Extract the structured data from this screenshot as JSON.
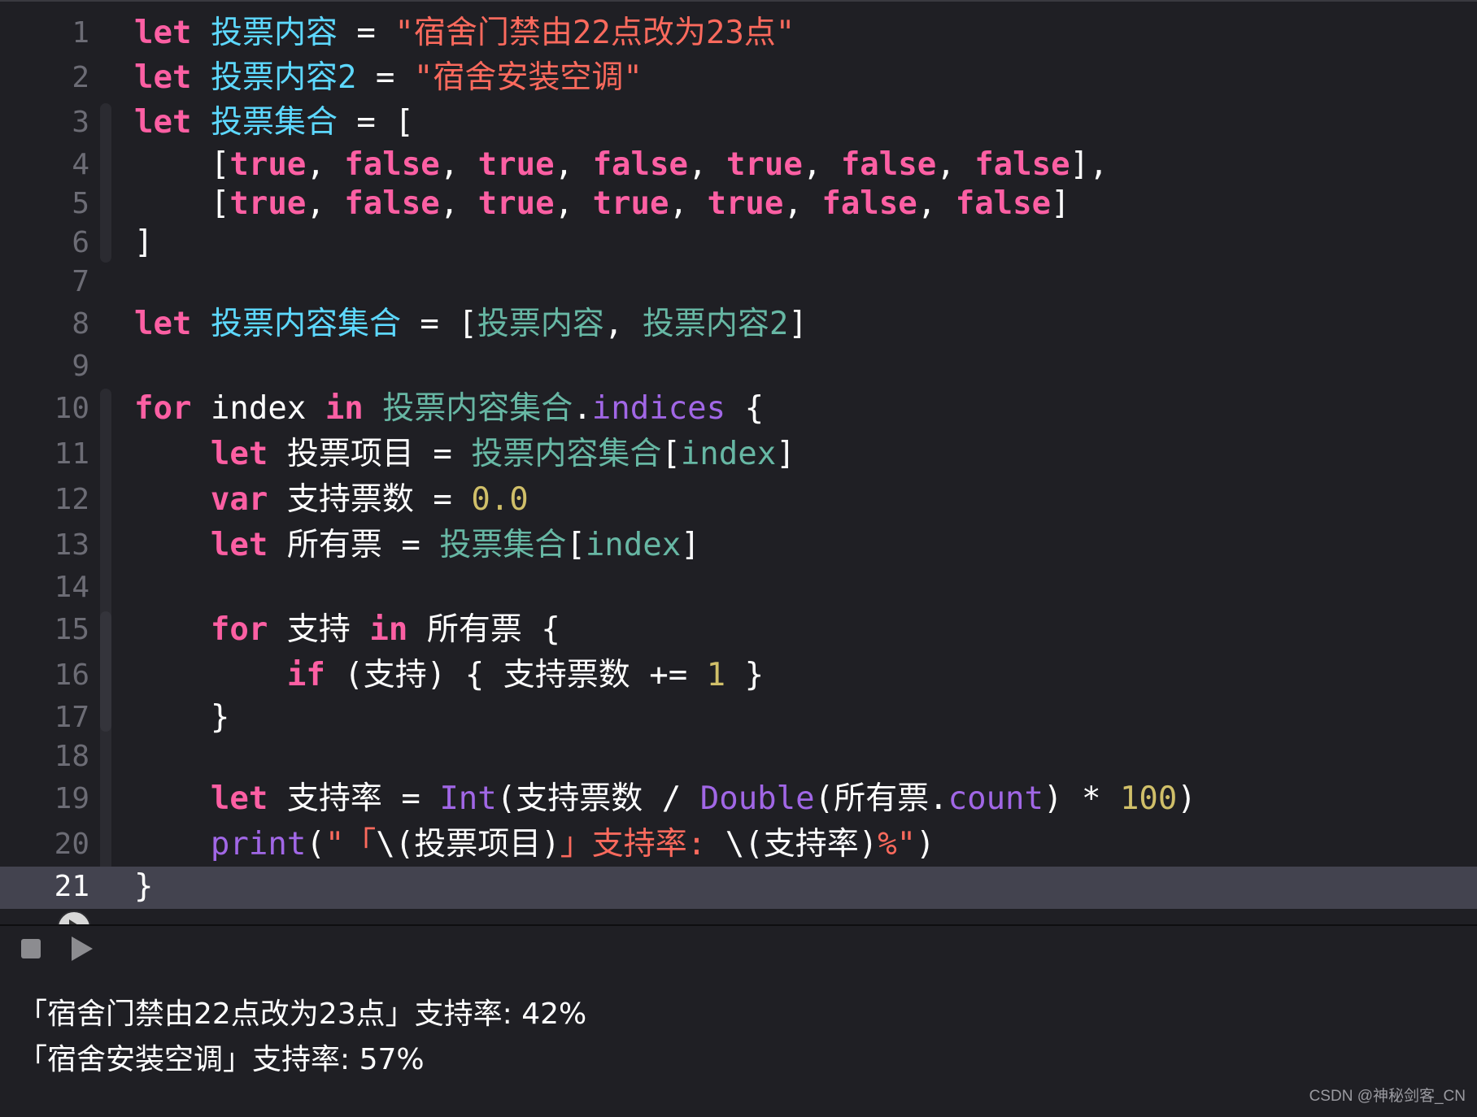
{
  "editor": {
    "line_numbers": [
      "1",
      "2",
      "3",
      "4",
      "5",
      "6",
      "7",
      "8",
      "9",
      "10",
      "11",
      "12",
      "13",
      "14",
      "15",
      "16",
      "17",
      "18",
      "19",
      "20",
      "21"
    ],
    "current_line": "21",
    "tokens": {
      "let": "let",
      "var": "var",
      "for": "for",
      "in": "in",
      "if": "if",
      "true": "true",
      "false": "false",
      "eq": " = ",
      "comma": ", ",
      "lbracket": "[",
      "rbracket": "]",
      "lbrace": "{",
      "rbrace": "}",
      "v_content": "投票内容",
      "v_content2": "投票内容2",
      "v_set": "投票集合",
      "v_content_set": "投票内容集合",
      "v_item": "投票项目",
      "v_votes": "支持票数",
      "v_all": "所有票",
      "v_support": "支持",
      "v_rate": "支持率",
      "index": "index",
      "s1": "\"宿舍门禁由22点改为23点\"",
      "s2": "\"宿舍安装空调\"",
      "n0": "0.0",
      "n1": "1",
      "n100": "100",
      "indices": "indices",
      "count": "count",
      "Int": "Int",
      "Double": "Double",
      "print": "print",
      "print_s1": "\"「",
      "print_s2": "」支持率: ",
      "print_s3": "%\""
    }
  },
  "console": {
    "lines": [
      "「宿舍门禁由22点改为23点」支持率: 42%",
      "「宿舍安装空调」支持率: 57%"
    ]
  },
  "watermark": "CSDN @神秘剑客_CN",
  "colors": {
    "background": "#1f1f24",
    "keyword": "#fc5fa3",
    "declaration": "#5dd8ff",
    "reference": "#67b7a4",
    "string": "#fc6a5d",
    "number": "#d0bf69",
    "method": "#a167e6",
    "current_line": "#43434f"
  }
}
